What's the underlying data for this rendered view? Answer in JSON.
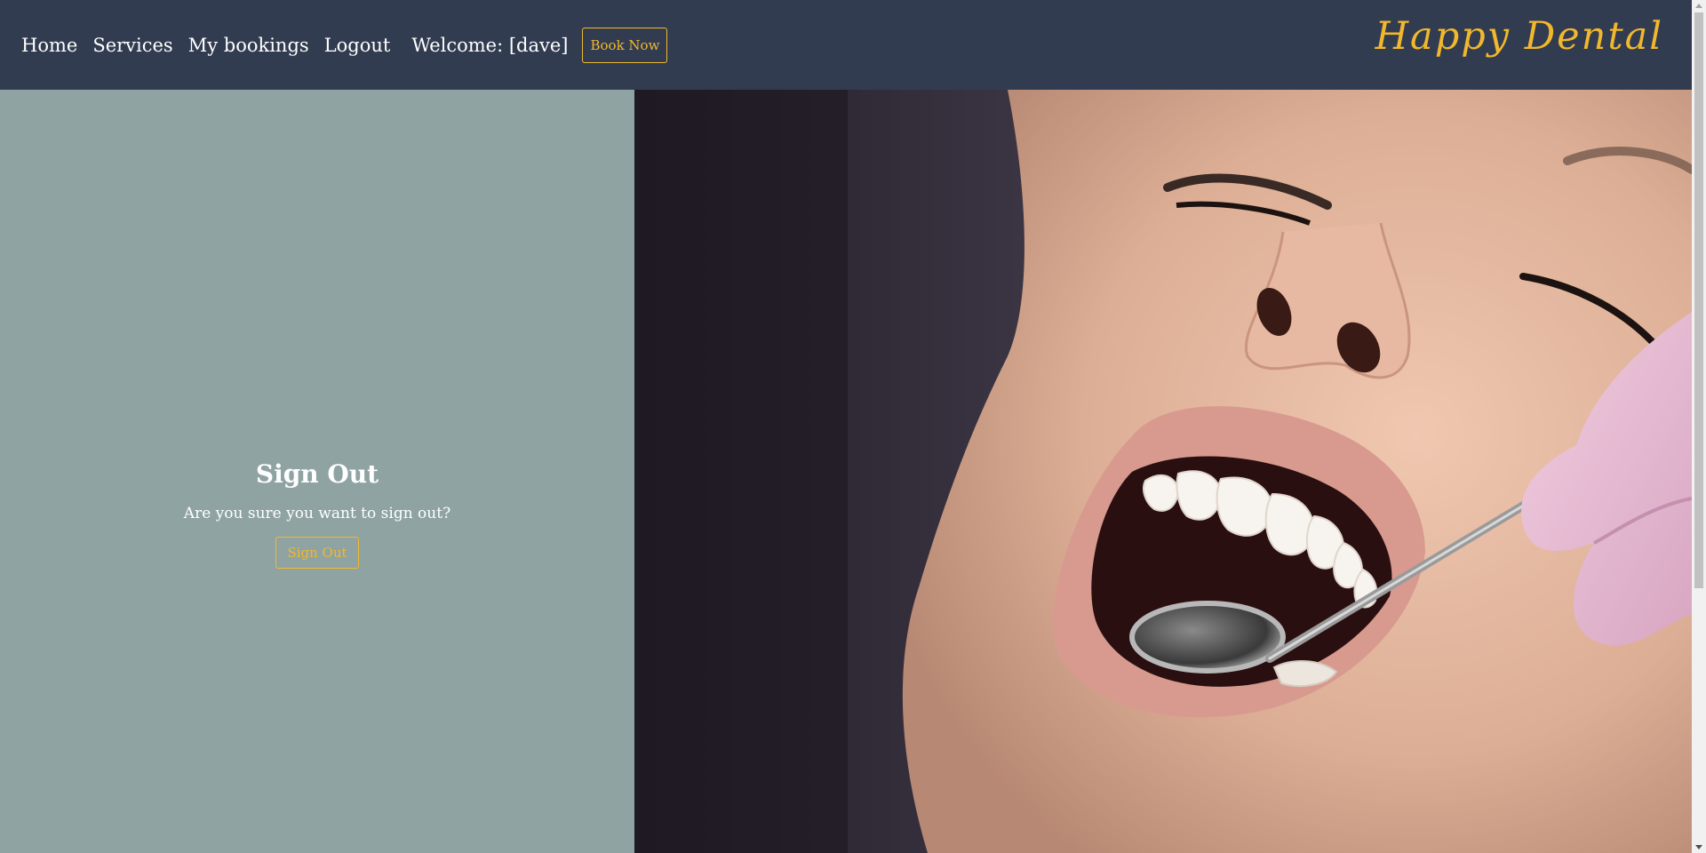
{
  "nav": {
    "links": [
      "Home",
      "Services",
      "My bookings",
      "Logout"
    ],
    "welcome": "Welcome: [dave]",
    "book_now_label": "Book Now",
    "brand": "Happy Dental"
  },
  "signout": {
    "title": "Sign Out",
    "message": "Are you sure you want to sign out?",
    "button_label": "Sign Out"
  },
  "hero": {
    "image_description_icon": "dental-checkup-photo"
  },
  "colors": {
    "navbar_bg": "#323c51",
    "panel_bg": "#8fa3a3",
    "accent": "#f1b82d",
    "text": "#ffffff"
  }
}
